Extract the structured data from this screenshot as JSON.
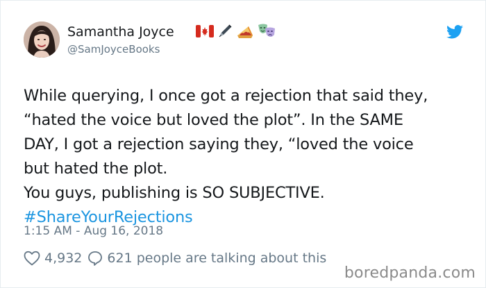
{
  "author": {
    "display_name": "Samantha Joyce",
    "handle": "@SamJoyceBooks",
    "name_emojis": [
      "canada-flag-icon",
      "pen-icon",
      "pie-icon",
      "theater-masks-icon"
    ]
  },
  "tweet": {
    "lines": [
      "While querying, I once got a rejection that said they,",
      "“hated the voice but loved the plot”. In the SAME",
      "DAY, I got a rejection saying they, “loved the voice",
      "but hated the plot.",
      "You guys, publishing is SO SUBJECTIVE."
    ],
    "hashtag": "#ShareYourRejections",
    "timestamp": "1:15 AM - Aug 16, 2018"
  },
  "stats": {
    "likes": "4,932",
    "talking": "621 people are talking about this"
  },
  "watermark": "boredpanda.com",
  "colors": {
    "twitter_blue": "#1da1f2",
    "hashtag": "#1b95e0",
    "muted": "#657786"
  }
}
